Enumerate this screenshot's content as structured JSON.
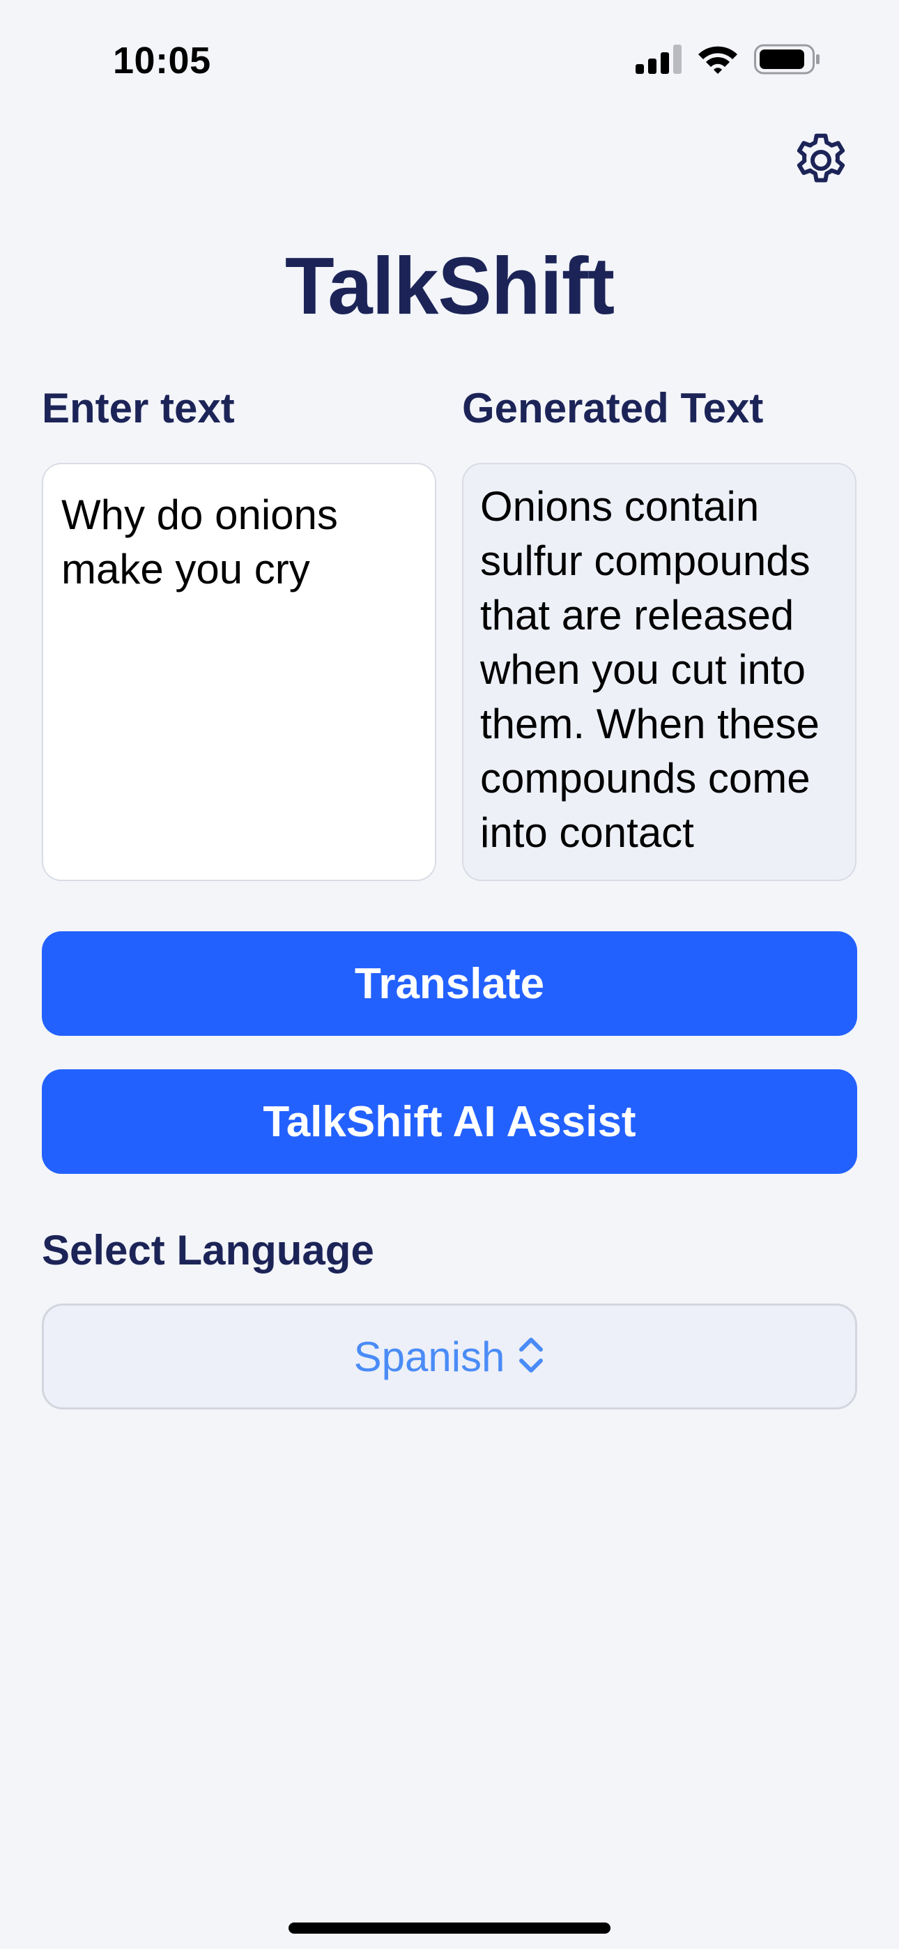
{
  "status_bar": {
    "time": "10:05",
    "icons": [
      "cellular-signal-icon",
      "wifi-icon",
      "battery-icon"
    ]
  },
  "header": {
    "settings_icon": "gear-icon",
    "title": "TalkShift"
  },
  "input_section": {
    "label": "Enter text",
    "value": "Why do onions make you cry"
  },
  "output_section": {
    "label": "Generated Text",
    "value": "Onions contain sulfur compounds that are released when you cut into them. When these compounds come into contact"
  },
  "actions": {
    "translate_label": "Translate",
    "assist_label": "TalkShift AI Assist"
  },
  "language": {
    "label": "Select Language",
    "selected": "Spanish",
    "picker_icon": "chevron-up-down-icon"
  },
  "colors": {
    "background": "#F3F5F9",
    "primary": "#2361FF",
    "heading": "#1C2457",
    "picker_text": "#4A8CF7"
  }
}
